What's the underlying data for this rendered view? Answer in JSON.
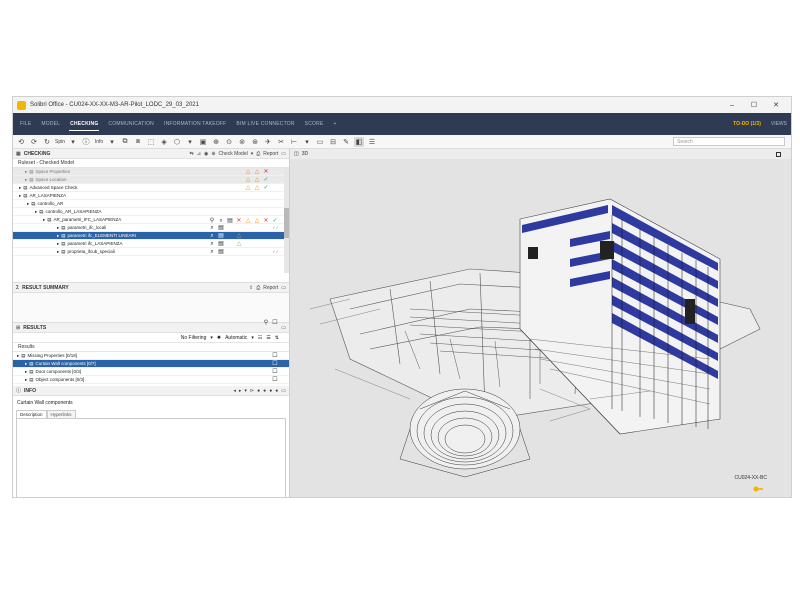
{
  "window": {
    "title": "Solibri Office - CU024-XX-XX-M3-AR-Pilot_LODC_29_03_2021"
  },
  "menu": {
    "items": [
      "FILE",
      "MODEL",
      "CHECKING",
      "COMMUNICATION",
      "INFORMATION TAKEOFF",
      "BIM LIVE CONNECTOR",
      "SCORE",
      "+"
    ],
    "active": "CHECKING",
    "todo": "TO-DO (1/3)",
    "views": "VIEWS"
  },
  "toolbar": {
    "spin_label": "Spin",
    "info_label": "Info",
    "search_placeholder": "Search"
  },
  "checking": {
    "panel_title": "CHECKING",
    "check_model_label": "Check Model",
    "report_label": "Report",
    "ruleset_label": "Ruleset - Checked Model",
    "rows": [
      {
        "label": "Space Properties",
        "indent": 12,
        "style": "grey"
      },
      {
        "label": "Space Location",
        "indent": 12,
        "style": "grey"
      },
      {
        "label": "Advanced Space Check",
        "indent": 6,
        "style": "normal"
      },
      {
        "label": "AR_LASAPIENZA",
        "indent": 6,
        "style": "normal"
      },
      {
        "label": "controllo_AR",
        "indent": 14,
        "style": "normal"
      },
      {
        "label": "controllo_AR_LASAPIENZA",
        "indent": 22,
        "style": "normal"
      },
      {
        "label": "AR_parametri_IFC_LASAPIENZA",
        "indent": 30,
        "style": "normal"
      },
      {
        "label": "parametri_ifc_locali",
        "indent": 44,
        "style": "normal"
      },
      {
        "label": "parametri ifc_ELEMENTI LINEARI",
        "indent": 44,
        "style": "selected"
      },
      {
        "label": "parametri ifc_LASAPIENZA",
        "indent": 44,
        "style": "normal"
      },
      {
        "label": "proprieta_ifcub_speciali",
        "indent": 44,
        "style": "normal"
      }
    ]
  },
  "result_summary": {
    "title": "RESULT SUMMARY",
    "report_label": "Report"
  },
  "results": {
    "title": "RESULTS",
    "filter_label": "No Filtering",
    "mode_label": "Automatic",
    "header_label": "Results",
    "rows": [
      {
        "label": "Missing Properties [0/18]",
        "indent": 4,
        "style": "normal"
      },
      {
        "label": "Curtain Wall components [0/7]",
        "indent": 12,
        "style": "selected"
      },
      {
        "label": "Door components [0/3]",
        "indent": 12,
        "style": "normal"
      },
      {
        "label": "Object components [0/3]",
        "indent": 12,
        "style": "normal"
      }
    ]
  },
  "info": {
    "title": "INFO",
    "selected_item": "Curtain Wall components",
    "tabs": [
      "Description",
      "Hyperlinks"
    ]
  },
  "viewport": {
    "title": "3D",
    "coord_label": "CU024-XX-BC"
  },
  "colors": {
    "menubar": "#2f3b52",
    "selection": "#2b62a8",
    "todo": "#f5b100",
    "warning": "#f0901e",
    "error": "#d9382b",
    "ok": "#3aaa4a"
  }
}
